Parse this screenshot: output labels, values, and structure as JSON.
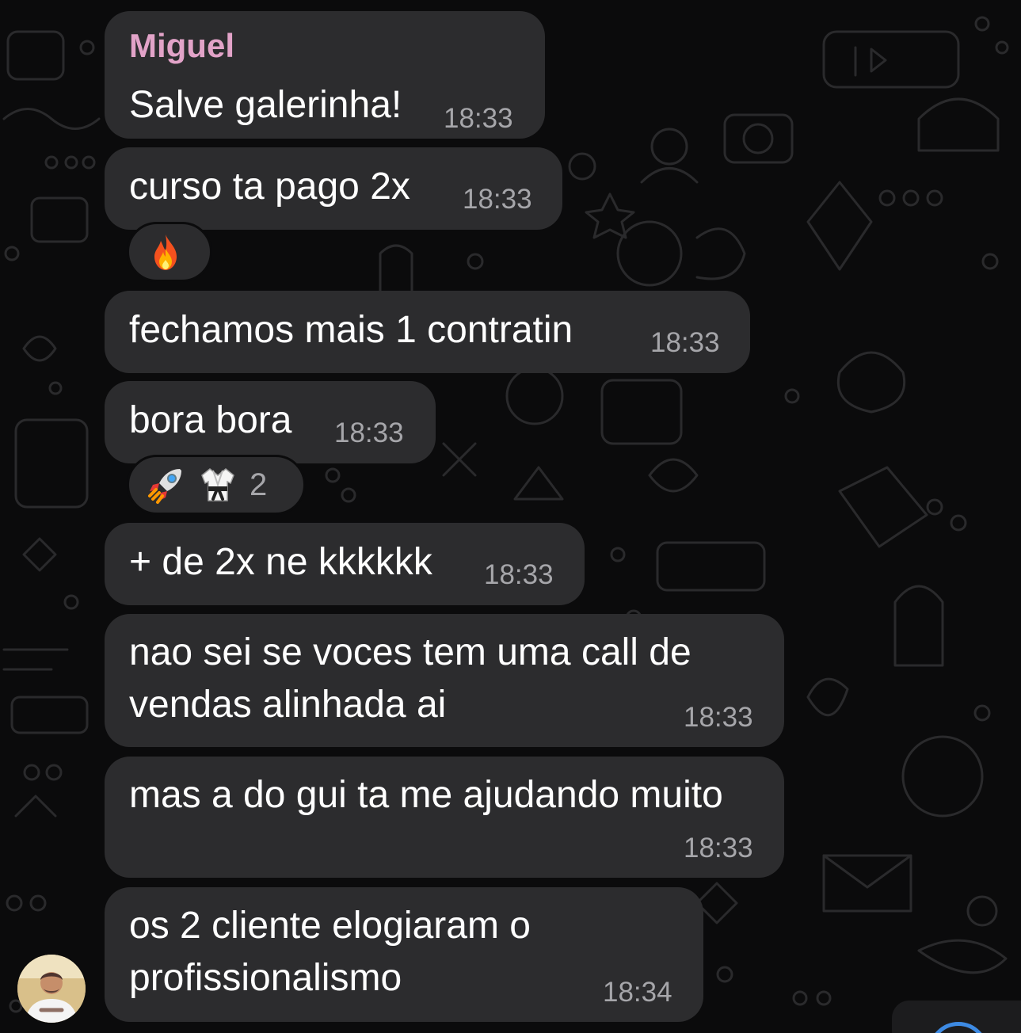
{
  "chat": {
    "sender_name": "Miguel",
    "colors": {
      "background": "#0b0b0c",
      "bubble": "#2c2c2e",
      "sender_name": "#e2a3c8",
      "timestamp": "#a6a6aa",
      "accent": "#3d8ae3"
    },
    "messages": [
      {
        "line1": "Salve galerinha!",
        "time": "18:33"
      },
      {
        "line1": "curso ta pago 2x",
        "time": "18:33"
      },
      {
        "line1": "fechamos mais 1 contratin",
        "time": "18:33"
      },
      {
        "line1": "bora bora",
        "time": "18:33"
      },
      {
        "line1": "+ de 2x ne kkkkkk",
        "time": "18:33"
      },
      {
        "line1": "nao sei se voces tem uma call de",
        "line2": "vendas alinhada ai",
        "time": "18:33"
      },
      {
        "line1": "mas a do gui ta me ajudando muito",
        "time": "18:33"
      },
      {
        "line1": "os 2 cliente elogiaram o",
        "line2": "profissionalismo",
        "time": "18:34"
      }
    ],
    "reactions": [
      {
        "after_message": 2,
        "emojis": [
          "fire-icon"
        ]
      },
      {
        "after_message": 4,
        "emojis": [
          "rocket-icon",
          "martial-arts-uniform-icon"
        ],
        "count": "2"
      }
    ],
    "avatar_icon": "user-avatar-photo"
  }
}
